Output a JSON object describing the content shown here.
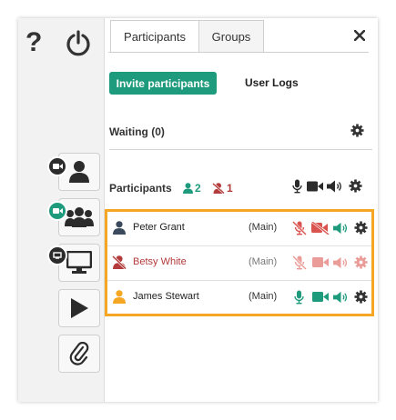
{
  "header": {
    "help_label": "?"
  },
  "tabs": [
    {
      "label": "Participants",
      "active": true
    },
    {
      "label": "Groups",
      "active": false
    }
  ],
  "toolbar": {
    "invite_label": "Invite participants",
    "user_logs_label": "User Logs"
  },
  "waiting": {
    "title": "Waiting (0)"
  },
  "participants_section": {
    "title": "Participants",
    "online_count": "2",
    "offline_count": "1"
  },
  "participants": [
    {
      "name": "Peter Grant",
      "room": "(Main)",
      "status": "online-muted"
    },
    {
      "name": "Betsy White",
      "room": "(Main)",
      "status": "offline"
    },
    {
      "name": "James Stewart",
      "room": "(Main)",
      "status": "active"
    }
  ],
  "colors": {
    "accent": "#1e9a7c",
    "danger": "#d9534f",
    "danger_light": "#ea9c98",
    "highlight": "#f5a623",
    "dark": "#2b2b2b"
  }
}
